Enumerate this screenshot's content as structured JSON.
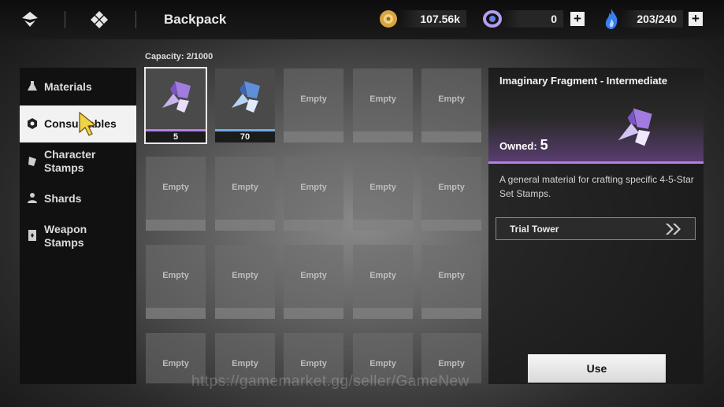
{
  "header": {
    "title": "Backpack",
    "icons": [
      "logo-icon",
      "diamond-menu-icon"
    ]
  },
  "resources": [
    {
      "name": "coin",
      "icon": "gold-coin-icon",
      "value": "107.56k"
    },
    {
      "name": "ring",
      "icon": "purple-ring-icon",
      "value": "0"
    },
    {
      "name": "stamina",
      "icon": "blue-flame-icon",
      "value": "203/240"
    }
  ],
  "plus_label": "+",
  "sidebar": {
    "items": [
      {
        "label": "Materials",
        "icon": "flask-icon"
      },
      {
        "label": "Consumables",
        "icon": "hexagon-icon"
      },
      {
        "label": "Character Stamps",
        "icon": "stamp-icon"
      },
      {
        "label": "Shards",
        "icon": "person-icon"
      },
      {
        "label": "Weapon Stamps",
        "icon": "card-icon"
      }
    ],
    "active": "Consumables"
  },
  "capacity": "Capacity: 2/1000",
  "grid": {
    "items": [
      {
        "count": "5",
        "rarity_color": "#b57ee8",
        "selected": true
      },
      {
        "count": "70",
        "rarity_color": "#6fa9e8",
        "selected": false
      }
    ],
    "empty_label": "Empty"
  },
  "detail": {
    "title": "Imaginary Fragment - Intermediate",
    "owned_label": "Owned:",
    "owned_value": "5",
    "description": "A general material for crafting specific 4-5-Star Set Stamps.",
    "source": "Trial Tower",
    "use_label": "Use"
  },
  "watermark": "https://gamemarket.gg/seller/GameNew",
  "colors": {
    "accent_purple": "#b57ee8",
    "accent_blue": "#6fa9e8"
  }
}
